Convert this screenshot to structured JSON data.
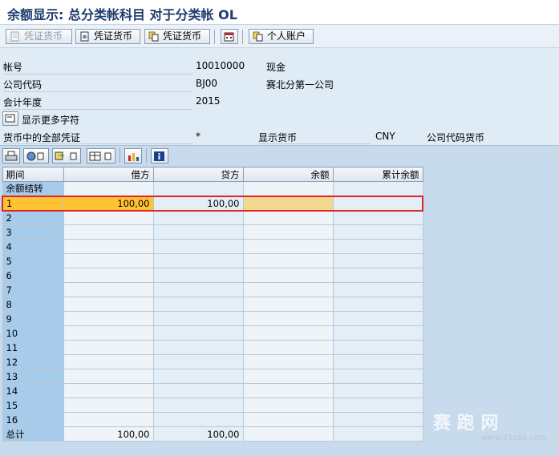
{
  "title": "余额显示: 总分类帐科目 对于分类帐 OL",
  "toolbar": {
    "buttons": [
      {
        "label": "凭证货币",
        "disabled": true
      },
      {
        "label": "凭证货币",
        "disabled": false
      },
      {
        "label": "凭证货币",
        "disabled": false
      },
      {
        "label": "个人账户",
        "disabled": false
      }
    ]
  },
  "header": {
    "account_label": "帐号",
    "account_value": "10010000",
    "account_desc": "现金",
    "company_label": "公司代码",
    "company_value": "BJ00",
    "company_desc": "赛北分第一公司",
    "year_label": "会计年度",
    "year_value": "2015",
    "more_chars_label": "显示更多字符",
    "all_docs_label": "货币中的全部凭证",
    "all_docs_value": "*",
    "display_curr_label": "显示货币",
    "display_curr_value": "CNY",
    "display_curr_desc": "公司代码货币"
  },
  "grid": {
    "columns": [
      "期间",
      "借方",
      "贷方",
      "余额",
      "累计余额"
    ],
    "rows": [
      {
        "period": "余额结转",
        "debit": "",
        "credit": "",
        "balance": "",
        "cumulative": ""
      },
      {
        "period": "1",
        "debit": "100,00",
        "credit": "100,00",
        "balance": "",
        "cumulative": ""
      },
      {
        "period": "2",
        "debit": "",
        "credit": "",
        "balance": "",
        "cumulative": ""
      },
      {
        "period": "3",
        "debit": "",
        "credit": "",
        "balance": "",
        "cumulative": ""
      },
      {
        "period": "4",
        "debit": "",
        "credit": "",
        "balance": "",
        "cumulative": ""
      },
      {
        "period": "5",
        "debit": "",
        "credit": "",
        "balance": "",
        "cumulative": ""
      },
      {
        "period": "6",
        "debit": "",
        "credit": "",
        "balance": "",
        "cumulative": ""
      },
      {
        "period": "7",
        "debit": "",
        "credit": "",
        "balance": "",
        "cumulative": ""
      },
      {
        "period": "8",
        "debit": "",
        "credit": "",
        "balance": "",
        "cumulative": ""
      },
      {
        "period": "9",
        "debit": "",
        "credit": "",
        "balance": "",
        "cumulative": ""
      },
      {
        "period": "10",
        "debit": "",
        "credit": "",
        "balance": "",
        "cumulative": ""
      },
      {
        "period": "11",
        "debit": "",
        "credit": "",
        "balance": "",
        "cumulative": ""
      },
      {
        "period": "12",
        "debit": "",
        "credit": "",
        "balance": "",
        "cumulative": ""
      },
      {
        "period": "13",
        "debit": "",
        "credit": "",
        "balance": "",
        "cumulative": ""
      },
      {
        "period": "14",
        "debit": "",
        "credit": "",
        "balance": "",
        "cumulative": ""
      },
      {
        "period": "15",
        "debit": "",
        "credit": "",
        "balance": "",
        "cumulative": ""
      },
      {
        "period": "16",
        "debit": "",
        "credit": "",
        "balance": "",
        "cumulative": ""
      },
      {
        "period": "总计",
        "debit": "100,00",
        "credit": "100,00",
        "balance": "",
        "cumulative": ""
      }
    ]
  },
  "watermark": {
    "text": "赛 跑 网",
    "url": "www.91sap.com"
  },
  "colors": {
    "selected_row": "#ffc233",
    "selected_border": "#e0242a",
    "row_header": "#a7cbea",
    "title": "#1e3c6e"
  }
}
